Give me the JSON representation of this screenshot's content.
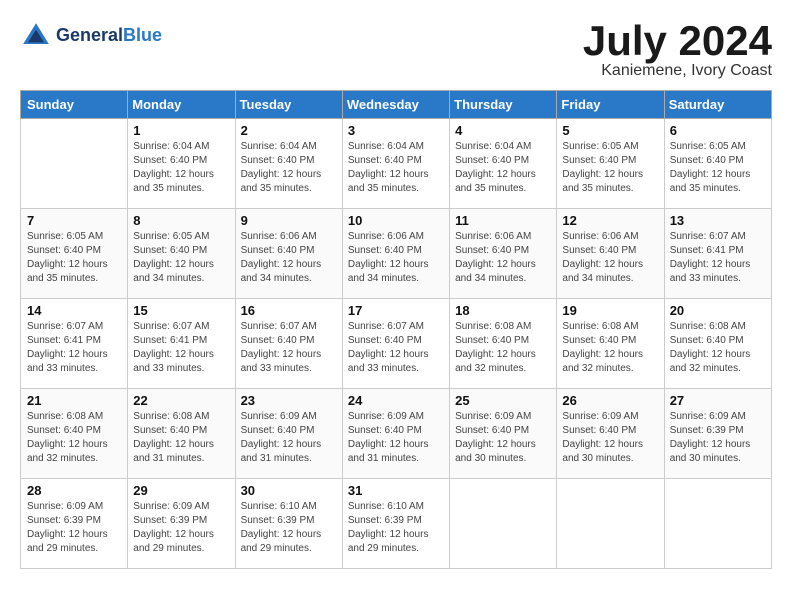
{
  "header": {
    "logo_line1": "General",
    "logo_line2": "Blue",
    "month_title": "July 2024",
    "location": "Kaniemene, Ivory Coast"
  },
  "calendar": {
    "days_of_week": [
      "Sunday",
      "Monday",
      "Tuesday",
      "Wednesday",
      "Thursday",
      "Friday",
      "Saturday"
    ],
    "weeks": [
      [
        {
          "num": "",
          "sunrise": "",
          "sunset": "",
          "daylight": ""
        },
        {
          "num": "1",
          "sunrise": "Sunrise: 6:04 AM",
          "sunset": "Sunset: 6:40 PM",
          "daylight": "Daylight: 12 hours and 35 minutes."
        },
        {
          "num": "2",
          "sunrise": "Sunrise: 6:04 AM",
          "sunset": "Sunset: 6:40 PM",
          "daylight": "Daylight: 12 hours and 35 minutes."
        },
        {
          "num": "3",
          "sunrise": "Sunrise: 6:04 AM",
          "sunset": "Sunset: 6:40 PM",
          "daylight": "Daylight: 12 hours and 35 minutes."
        },
        {
          "num": "4",
          "sunrise": "Sunrise: 6:04 AM",
          "sunset": "Sunset: 6:40 PM",
          "daylight": "Daylight: 12 hours and 35 minutes."
        },
        {
          "num": "5",
          "sunrise": "Sunrise: 6:05 AM",
          "sunset": "Sunset: 6:40 PM",
          "daylight": "Daylight: 12 hours and 35 minutes."
        },
        {
          "num": "6",
          "sunrise": "Sunrise: 6:05 AM",
          "sunset": "Sunset: 6:40 PM",
          "daylight": "Daylight: 12 hours and 35 minutes."
        }
      ],
      [
        {
          "num": "7",
          "sunrise": "Sunrise: 6:05 AM",
          "sunset": "Sunset: 6:40 PM",
          "daylight": "Daylight: 12 hours and 35 minutes."
        },
        {
          "num": "8",
          "sunrise": "Sunrise: 6:05 AM",
          "sunset": "Sunset: 6:40 PM",
          "daylight": "Daylight: 12 hours and 34 minutes."
        },
        {
          "num": "9",
          "sunrise": "Sunrise: 6:06 AM",
          "sunset": "Sunset: 6:40 PM",
          "daylight": "Daylight: 12 hours and 34 minutes."
        },
        {
          "num": "10",
          "sunrise": "Sunrise: 6:06 AM",
          "sunset": "Sunset: 6:40 PM",
          "daylight": "Daylight: 12 hours and 34 minutes."
        },
        {
          "num": "11",
          "sunrise": "Sunrise: 6:06 AM",
          "sunset": "Sunset: 6:40 PM",
          "daylight": "Daylight: 12 hours and 34 minutes."
        },
        {
          "num": "12",
          "sunrise": "Sunrise: 6:06 AM",
          "sunset": "Sunset: 6:40 PM",
          "daylight": "Daylight: 12 hours and 34 minutes."
        },
        {
          "num": "13",
          "sunrise": "Sunrise: 6:07 AM",
          "sunset": "Sunset: 6:41 PM",
          "daylight": "Daylight: 12 hours and 33 minutes."
        }
      ],
      [
        {
          "num": "14",
          "sunrise": "Sunrise: 6:07 AM",
          "sunset": "Sunset: 6:41 PM",
          "daylight": "Daylight: 12 hours and 33 minutes."
        },
        {
          "num": "15",
          "sunrise": "Sunrise: 6:07 AM",
          "sunset": "Sunset: 6:41 PM",
          "daylight": "Daylight: 12 hours and 33 minutes."
        },
        {
          "num": "16",
          "sunrise": "Sunrise: 6:07 AM",
          "sunset": "Sunset: 6:40 PM",
          "daylight": "Daylight: 12 hours and 33 minutes."
        },
        {
          "num": "17",
          "sunrise": "Sunrise: 6:07 AM",
          "sunset": "Sunset: 6:40 PM",
          "daylight": "Daylight: 12 hours and 33 minutes."
        },
        {
          "num": "18",
          "sunrise": "Sunrise: 6:08 AM",
          "sunset": "Sunset: 6:40 PM",
          "daylight": "Daylight: 12 hours and 32 minutes."
        },
        {
          "num": "19",
          "sunrise": "Sunrise: 6:08 AM",
          "sunset": "Sunset: 6:40 PM",
          "daylight": "Daylight: 12 hours and 32 minutes."
        },
        {
          "num": "20",
          "sunrise": "Sunrise: 6:08 AM",
          "sunset": "Sunset: 6:40 PM",
          "daylight": "Daylight: 12 hours and 32 minutes."
        }
      ],
      [
        {
          "num": "21",
          "sunrise": "Sunrise: 6:08 AM",
          "sunset": "Sunset: 6:40 PM",
          "daylight": "Daylight: 12 hours and 32 minutes."
        },
        {
          "num": "22",
          "sunrise": "Sunrise: 6:08 AM",
          "sunset": "Sunset: 6:40 PM",
          "daylight": "Daylight: 12 hours and 31 minutes."
        },
        {
          "num": "23",
          "sunrise": "Sunrise: 6:09 AM",
          "sunset": "Sunset: 6:40 PM",
          "daylight": "Daylight: 12 hours and 31 minutes."
        },
        {
          "num": "24",
          "sunrise": "Sunrise: 6:09 AM",
          "sunset": "Sunset: 6:40 PM",
          "daylight": "Daylight: 12 hours and 31 minutes."
        },
        {
          "num": "25",
          "sunrise": "Sunrise: 6:09 AM",
          "sunset": "Sunset: 6:40 PM",
          "daylight": "Daylight: 12 hours and 30 minutes."
        },
        {
          "num": "26",
          "sunrise": "Sunrise: 6:09 AM",
          "sunset": "Sunset: 6:40 PM",
          "daylight": "Daylight: 12 hours and 30 minutes."
        },
        {
          "num": "27",
          "sunrise": "Sunrise: 6:09 AM",
          "sunset": "Sunset: 6:39 PM",
          "daylight": "Daylight: 12 hours and 30 minutes."
        }
      ],
      [
        {
          "num": "28",
          "sunrise": "Sunrise: 6:09 AM",
          "sunset": "Sunset: 6:39 PM",
          "daylight": "Daylight: 12 hours and 29 minutes."
        },
        {
          "num": "29",
          "sunrise": "Sunrise: 6:09 AM",
          "sunset": "Sunset: 6:39 PM",
          "daylight": "Daylight: 12 hours and 29 minutes."
        },
        {
          "num": "30",
          "sunrise": "Sunrise: 6:10 AM",
          "sunset": "Sunset: 6:39 PM",
          "daylight": "Daylight: 12 hours and 29 minutes."
        },
        {
          "num": "31",
          "sunrise": "Sunrise: 6:10 AM",
          "sunset": "Sunset: 6:39 PM",
          "daylight": "Daylight: 12 hours and 29 minutes."
        },
        {
          "num": "",
          "sunrise": "",
          "sunset": "",
          "daylight": ""
        },
        {
          "num": "",
          "sunrise": "",
          "sunset": "",
          "daylight": ""
        },
        {
          "num": "",
          "sunrise": "",
          "sunset": "",
          "daylight": ""
        }
      ]
    ]
  }
}
